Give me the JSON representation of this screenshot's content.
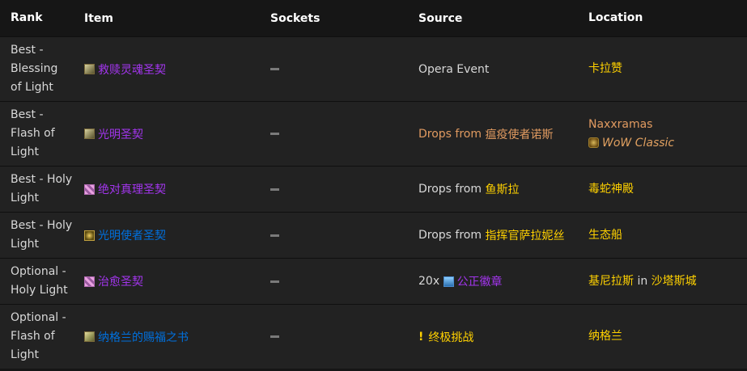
{
  "headers": [
    "Rank",
    "Item",
    "Sockets",
    "Source",
    "Location"
  ],
  "rows": [
    {
      "rank": [
        "Best -",
        "Blessing",
        "of Light"
      ],
      "item": {
        "name": "救赎灵魂圣契",
        "icon": "libram-icon"
      },
      "sockets": "",
      "source": {
        "text": "Opera Event"
      },
      "location": [
        "卡拉赞"
      ]
    },
    {
      "rank": [
        "Best -",
        "Flash of",
        "Light"
      ],
      "item": {
        "name": "光明圣契",
        "icon": "libram-icon"
      },
      "sockets": "",
      "source": {
        "prefix": "Drops from",
        "link": "瘟疫使者诺斯"
      },
      "location": [
        "Naxxramas",
        "WoW Classic"
      ]
    },
    {
      "rank": [
        "Best - Holy",
        "Light"
      ],
      "item": {
        "name": "绝对真理圣契",
        "icon": "libram-icon"
      },
      "sockets": "",
      "source": {
        "prefix": "Drops from",
        "link": "鱼斯拉"
      },
      "location": [
        "毒蛇神殿"
      ]
    },
    {
      "rank": [
        "Best - Holy",
        "Light"
      ],
      "item": {
        "name": "光明使者圣契",
        "icon": "libram-icon"
      },
      "sockets": "",
      "source": {
        "prefix": "Drops from",
        "link": "指挥官萨拉妮丝"
      },
      "location": [
        "生态船"
      ]
    },
    {
      "rank": [
        "Optional -",
        "Holy Light"
      ],
      "item": {
        "name": "治愈圣契",
        "icon": "libram-icon"
      },
      "sockets": "",
      "source": {
        "prefix": "20x",
        "link": "公正徽章"
      },
      "location": [
        "基尼拉斯",
        "in",
        "沙塔斯城"
      ]
    },
    {
      "rank": [
        "Optional -",
        "Flash of",
        "Light"
      ],
      "item": {
        "name": "纳格兰的赐福之书",
        "icon": "book-icon"
      },
      "sockets": "",
      "source": {
        "quest": "终极挑战"
      },
      "location": [
        "纳格兰"
      ]
    }
  ],
  "colors": {
    "epic": "#a335ee",
    "rare": "#0070dd",
    "zone": "#ffd100",
    "drop_orange": "#e09a60"
  }
}
